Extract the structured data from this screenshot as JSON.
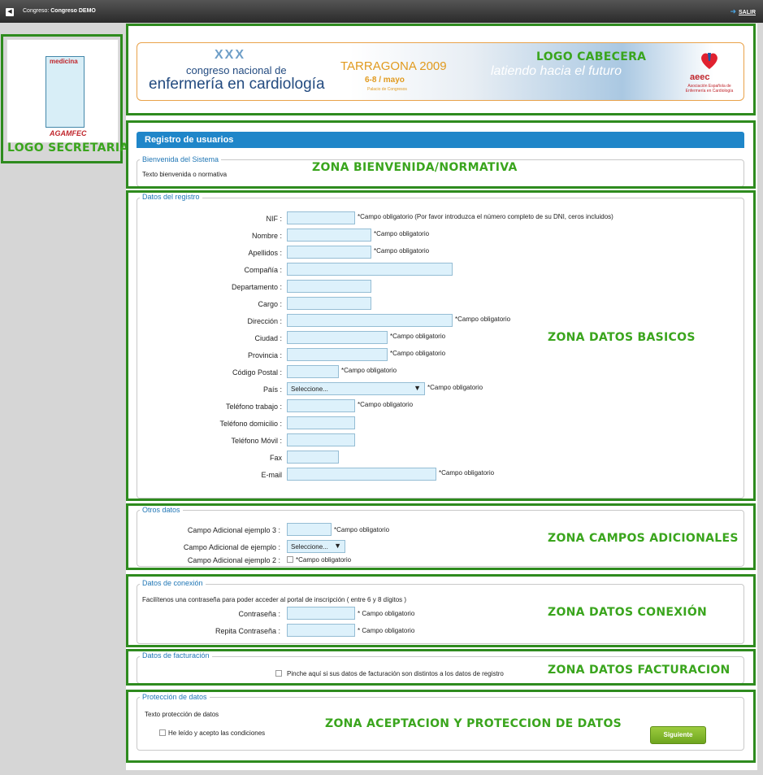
{
  "topbar": {
    "congress_label": "Congreso:",
    "congress_name": "Congreso DEMO",
    "exit_label": "SALIR"
  },
  "logos": {
    "secretaria_word": "medicina",
    "secretaria_name": "AGAMFEC",
    "header": {
      "edition": "XXX",
      "line1": "congreso nacional de",
      "line2": "enfermería en cardiología",
      "city": "TARRAGONA 2009",
      "dates": "6-8 / mayo",
      "venue": "Palacio de Congresos",
      "slogan": "latiendo hacia el futuro",
      "org_acronym": "aeec",
      "org_name": "Asociación Española de Enfermería en Cardiología"
    }
  },
  "zones": {
    "secretaria": "LOGO SECRETARIA",
    "cabecera": "LOGO CABECERA",
    "bienvenida": "ZONA BIENVENIDA/NORMATIVA",
    "basicos": "ZONA DATOS BASICOS",
    "adicionales": "ZONA CAMPOS ADICIONALES",
    "conexion": "ZONA DATOS CONEXIÓN",
    "facturacion": "ZONA DATOS FACTURACION",
    "proteccion": "ZONA ACEPTACION Y PROTECCION DE DATOS"
  },
  "page_title": "Registro de usuarios",
  "welcome": {
    "legend": "Bienvenida del Sistema",
    "text": "Texto bienvenida o normativa"
  },
  "registro": {
    "legend": "Datos del registro",
    "fields": [
      {
        "label": "NIF :",
        "note": "*Campo obligatorio (Por favor introduzca el número completo de su DNI, ceros incluidos)"
      },
      {
        "label": "Nombre :",
        "note": "*Campo obligatorio"
      },
      {
        "label": "Apellidos :",
        "note": "*Campo obligatorio"
      },
      {
        "label": "Compañía :",
        "note": ""
      },
      {
        "label": "Departamento :",
        "note": ""
      },
      {
        "label": "Cargo :",
        "note": ""
      },
      {
        "label": "Dirección :",
        "note": "*Campo obligatorio"
      },
      {
        "label": "Ciudad :",
        "note": "*Campo obligatorio"
      },
      {
        "label": "Provincia :",
        "note": "*Campo obligatorio"
      },
      {
        "label": "Código Postal :",
        "note": "*Campo obligatorio"
      },
      {
        "label": "País :",
        "note": "*Campo obligatorio",
        "select_value": "Seleccione..."
      },
      {
        "label": "Teléfono trabajo :",
        "note": "*Campo obligatorio"
      },
      {
        "label": "Teléfono domicilio :",
        "note": ""
      },
      {
        "label": "Teléfono Móvil :",
        "note": ""
      },
      {
        "label": "Fax",
        "note": ""
      },
      {
        "label": "E-mail",
        "note": "*Campo obligatorio"
      }
    ]
  },
  "otros": {
    "legend": "Otros datos",
    "field1_label": "Campo Adicional ejemplo 3 :",
    "field1_note": "*Campo obligatorio",
    "field2_label": "Campo Adicional de ejemplo :",
    "field2_value": "Seleccione...",
    "field3_label": "Campo Adicional ejemplo 2 :",
    "field3_note": "*Campo obligatorio"
  },
  "conexion": {
    "legend": "Datos de conexión",
    "intro": "Facilítenos una contraseña para poder acceder al portal de inscripción ( entre 6 y 8 dígitos )",
    "pwd_label": "Contraseña :",
    "pwd_note": "* Campo obligatorio",
    "pwd2_label": "Repita Contraseña :",
    "pwd2_note": "* Campo obligatorio"
  },
  "facturacion": {
    "legend": "Datos de facturación",
    "checkbox_label": "Pinche aquí si sus datos de facturación son distintos a los datos de registro"
  },
  "proteccion": {
    "legend": "Protección de datos",
    "text": "Texto protección de datos",
    "checkbox_label": "He leído y acepto las condiciones",
    "next_button": "Siguiente"
  }
}
